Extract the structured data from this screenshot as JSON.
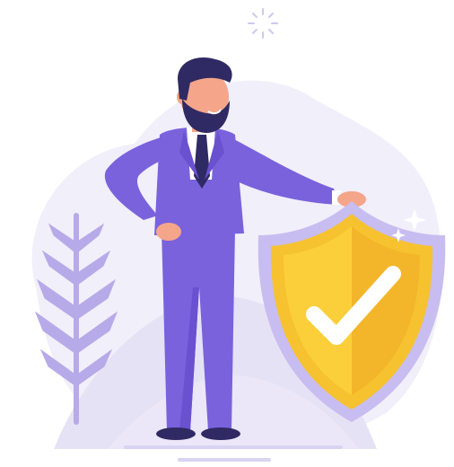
{
  "illustration": {
    "subject": "security-protection",
    "icons": [
      "sun-icon",
      "leaf-plant-icon",
      "shield-check-icon",
      "sparkle-icon"
    ],
    "colors": {
      "background_blob": "#f1effa",
      "hill": "#e6e2f6",
      "plant": "#b7aae8",
      "suit": "#7a62dd",
      "suit_shadow": "#6a51cf",
      "skin": "#f4a58a",
      "hair": "#2f2a63",
      "shirt": "#ffffff",
      "tie": "#2f2a63",
      "shield_outer": "#c8bdf0",
      "shield_mid": "#f6c230",
      "shield_inner": "#fbcf3a",
      "shield_shade": "#f3b62a",
      "check": "#ffffff",
      "ground": "#d9d3f3"
    }
  }
}
